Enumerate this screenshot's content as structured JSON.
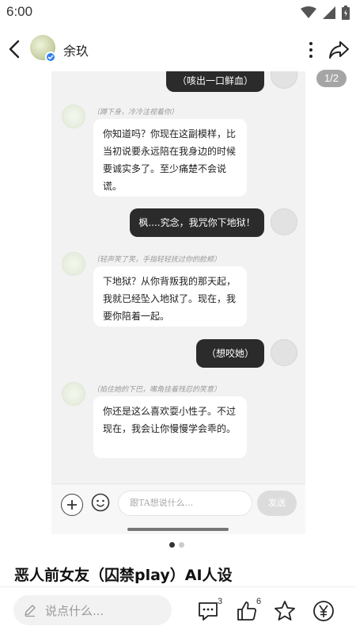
{
  "status_bar": {
    "time": "6:00"
  },
  "header": {
    "author_name": "余玖"
  },
  "preview": {
    "page_indicator": "1/2",
    "messages": [
      {
        "role": "user",
        "text": "（咳出一口鲜血）"
      },
      {
        "role": "bot",
        "action": "（蹲下身，冷冷注视着你）",
        "text": "你知道吗？你现在这副模样，比当初说要永远陪在我身边的时候要诚实多了。至少痛楚不会说谎。"
      },
      {
        "role": "user",
        "text": "枫....究念，我咒你下地狱！"
      },
      {
        "role": "bot",
        "action": "（轻声笑了笑，手指轻轻抚过你的脸颊）",
        "text": "下地狱？从你背叛我的那天起，我就已经坠入地狱了。现在，我要你陪着一起。"
      },
      {
        "role": "user",
        "text": "（想咬她）"
      },
      {
        "role": "bot",
        "action": "（掐住她的下巴，嘴角挂着残忍的笑意）",
        "text": "你还是这么喜欢耍小性子。不过现在，我会让你慢慢学会乖的。"
      }
    ],
    "input_placeholder": "跟TA想说什么...",
    "send_label": "发送"
  },
  "post": {
    "title": "恶人前女友（囚禁play）AI人设"
  },
  "bottom_bar": {
    "comment_placeholder": "说点什么...",
    "comment_count": "3",
    "like_count": "6"
  }
}
